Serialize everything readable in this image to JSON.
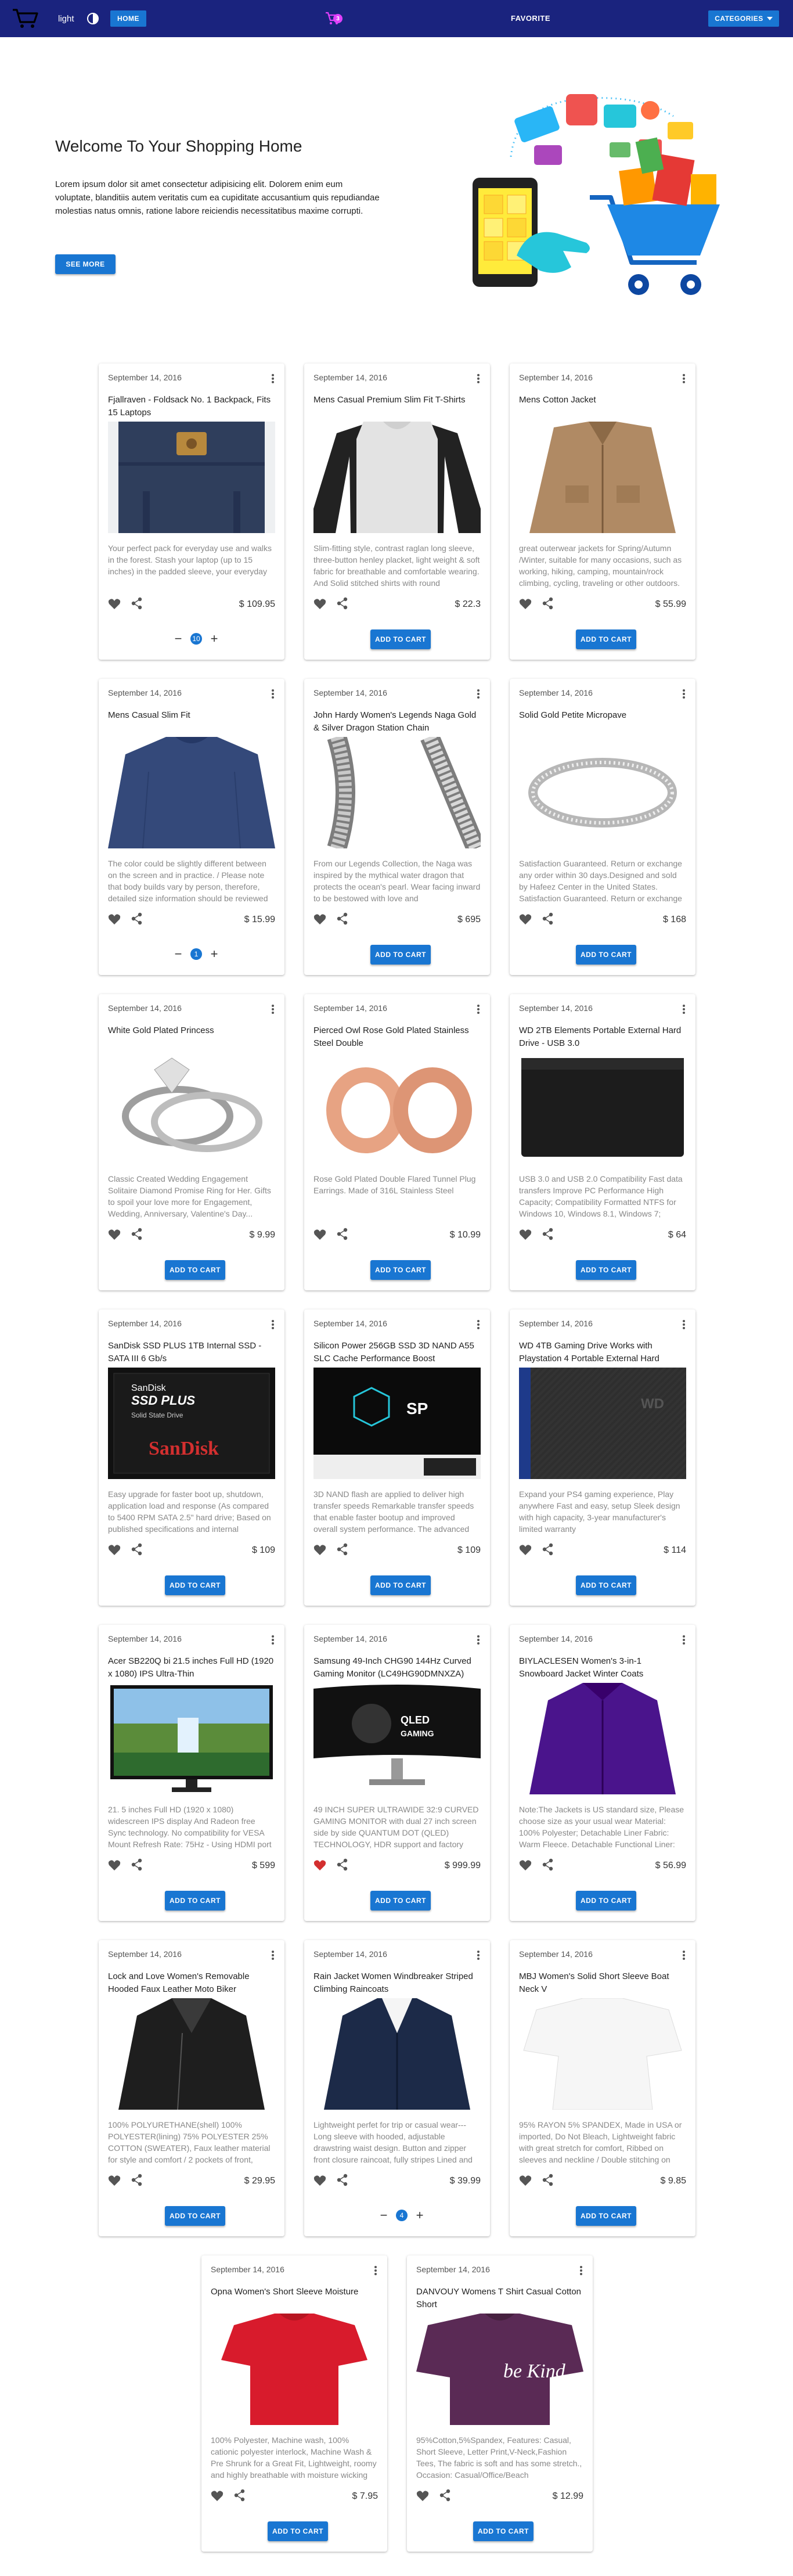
{
  "header": {
    "theme_label": "light",
    "home_label": "HOME",
    "cart_count": "3",
    "favorite_label": "FAVORITE",
    "categories_label": "CATEGORIES"
  },
  "hero": {
    "title": "Welcome To Your Shopping Home",
    "text": "Lorem ipsum dolor sit amet consectetur adipisicing elit. Dolorem enim eum voluptate, blanditiis autem veritatis cum ea cupiditate accusantium quis repudiandae molestias natus omnis, ratione labore reiciendis necessitatibus maxime corrupti.",
    "button": "SEE MORE"
  },
  "add_to_cart_label": "ADD TO CART",
  "products": [
    {
      "date": "September 14, 2016",
      "title": "Fjallraven - Foldsack No. 1 Backpack, Fits 15 Laptops",
      "desc": "Your perfect pack for everyday use and walks in the forest. Stash your laptop (up to 15 inches) in the padded sleeve, your everyday",
      "price": "$ 109.95",
      "qty": "10",
      "fav": false,
      "img": "backpack"
    },
    {
      "date": "September 14, 2016",
      "title": "Mens Casual Premium Slim Fit T-Shirts",
      "desc": "Slim-fitting style, contrast raglan long sleeve, three-button henley placket, light weight & soft fabric for breathable and comfortable wearing. And Solid stitched shirts with round",
      "price": "$ 22.3",
      "qty": null,
      "fav": false,
      "img": "tshirt"
    },
    {
      "date": "September 14, 2016",
      "title": "Mens Cotton Jacket",
      "desc": "great outerwear jackets for Spring/Autumn /Winter, suitable for many occasions, such as working, hiking, camping, mountain/rock climbing, cycling, traveling or other outdoors.",
      "price": "$ 55.99",
      "qty": null,
      "fav": false,
      "img": "jacket"
    },
    {
      "date": "September 14, 2016",
      "title": "Mens Casual Slim Fit",
      "desc": "The color could be slightly different between on the screen and in practice. / Please note that body builds vary by person, therefore, detailed size information should be reviewed",
      "price": "$ 15.99",
      "qty": "1",
      "fav": false,
      "img": "longsleeve"
    },
    {
      "date": "September 14, 2016",
      "title": "John Hardy Women's Legends Naga Gold & Silver Dragon Station Chain",
      "desc": "From our Legends Collection, the Naga was inspired by the mythical water dragon that protects the ocean's pearl. Wear facing inward to be bestowed with love and",
      "price": "$ 695",
      "qty": null,
      "fav": false,
      "img": "chain"
    },
    {
      "date": "September 14, 2016",
      "title": "Solid Gold Petite Micropave",
      "desc": "Satisfaction Guaranteed. Return or exchange any order within 30 days.Designed and sold by Hafeez Center in the United States. Satisfaction Guaranteed. Return or exchange",
      "price": "$ 168",
      "qty": null,
      "fav": false,
      "img": "ring"
    },
    {
      "date": "September 14, 2016",
      "title": "White Gold Plated Princess",
      "desc": "Classic Created Wedding Engagement Solitaire Diamond Promise Ring for Her. Gifts to spoil your love more for Engagement, Wedding, Anniversary, Valentine's Day...",
      "price": "$ 9.99",
      "qty": null,
      "fav": false,
      "img": "rings2"
    },
    {
      "date": "September 14, 2016",
      "title": "Pierced Owl Rose Gold Plated Stainless Steel Double",
      "desc": "Rose Gold Plated Double Flared Tunnel Plug Earrings. Made of 316L Stainless Steel",
      "price": "$ 10.99",
      "qty": null,
      "fav": false,
      "img": "plugs"
    },
    {
      "date": "September 14, 2016",
      "title": "WD 2TB Elements Portable External Hard Drive - USB 3.0",
      "desc": "USB 3.0 and USB 2.0 Compatibility Fast data transfers Improve PC Performance High Capacity; Compatibility Formatted NTFS for Windows 10, Windows 8.1, Windows 7;",
      "price": "$ 64",
      "qty": null,
      "fav": false,
      "img": "hdd"
    },
    {
      "date": "September 14, 2016",
      "title": "SanDisk SSD PLUS 1TB Internal SSD - SATA III 6 Gb/s",
      "desc": "Easy upgrade for faster boot up, shutdown, application load and response (As compared to 5400 RPM SATA 2.5\" hard drive; Based on published specifications and internal",
      "price": "$ 109",
      "qty": null,
      "fav": false,
      "img": "sandisk"
    },
    {
      "date": "September 14, 2016",
      "title": "Silicon Power 256GB SSD 3D NAND A55 SLC Cache Performance Boost",
      "desc": "3D NAND flash are applied to deliver high transfer speeds Remarkable transfer speeds that enable faster bootup and improved overall system performance. The advanced",
      "price": "$ 109",
      "qty": null,
      "fav": false,
      "img": "sp"
    },
    {
      "date": "September 14, 2016",
      "title": "WD 4TB Gaming Drive Works with Playstation 4 Portable External Hard",
      "desc": "Expand your PS4 gaming experience, Play anywhere Fast and easy, setup Sleek design with high capacity, 3-year manufacturer's limited warranty",
      "price": "$ 114",
      "qty": null,
      "fav": false,
      "img": "wd4"
    },
    {
      "date": "September 14, 2016",
      "title": "Acer SB220Q bi 21.5 inches Full HD (1920 x 1080) IPS Ultra-Thin",
      "desc": "21. 5 inches Full HD (1920 x 1080) widescreen IPS display And Radeon free Sync technology. No compatibility for VESA Mount Refresh Rate: 75Hz - Using HDMI port",
      "price": "$ 599",
      "qty": null,
      "fav": false,
      "img": "acer"
    },
    {
      "date": "September 14, 2016",
      "title": "Samsung 49-Inch CHG90 144Hz Curved Gaming Monitor (LC49HG90DMNXZA)",
      "desc": "49 INCH SUPER ULTRAWIDE 32:9 CURVED GAMING MONITOR with dual 27 inch screen side by side QUANTUM DOT (QLED) TECHNOLOGY, HDR support and factory",
      "price": "$ 999.99",
      "qty": null,
      "fav": true,
      "img": "samsung"
    },
    {
      "date": "September 14, 2016",
      "title": "BIYLACLESEN Women's 3-in-1 Snowboard Jacket Winter Coats",
      "desc": "Note:The Jackets is US standard size, Please choose size as your usual wear Material: 100% Polyester; Detachable Liner Fabric: Warm Fleece. Detachable Functional Liner:",
      "price": "$ 56.99",
      "qty": null,
      "fav": false,
      "img": "purplejacket"
    },
    {
      "date": "September 14, 2016",
      "title": "Lock and Love Women's Removable Hooded Faux Leather Moto Biker",
      "desc": "100% POLYURETHANE(shell) 100% POLYESTER(lining) 75% POLYESTER 25% COTTON (SWEATER), Faux leather material for style and comfort / 2 pockets of front,",
      "price": "$ 29.95",
      "qty": null,
      "fav": false,
      "img": "leather"
    },
    {
      "date": "September 14, 2016",
      "title": "Rain Jacket Women Windbreaker Striped Climbing Raincoats",
      "desc": "Lightweight perfet for trip or casual wear---Long sleeve with hooded, adjustable drawstring waist design. Button and zipper front closure raincoat, fully stripes Lined and",
      "price": "$ 39.99",
      "qty": "4",
      "fav": false,
      "img": "raincoat"
    },
    {
      "date": "September 14, 2016",
      "title": "MBJ Women's Solid Short Sleeve Boat Neck V",
      "desc": "95% RAYON 5% SPANDEX, Made in USA or imported, Do Not Bleach, Lightweight fabric with great stretch for comfort, Ribbed on sleeves and neckline / Double stitching on",
      "price": "$ 9.85",
      "qty": null,
      "fav": false,
      "img": "whitetop"
    },
    {
      "date": "September 14, 2016",
      "title": "Opna Women's Short Sleeve Moisture",
      "desc": "100% Polyester, Machine wash, 100% cationic polyester interlock, Machine Wash & Pre Shrunk for a Great Fit, Lightweight, roomy and highly breathable with moisture wicking",
      "price": "$ 7.95",
      "qty": null,
      "fav": false,
      "img": "redtee"
    },
    {
      "date": "September 14, 2016",
      "title": "DANVOUY Womens T Shirt Casual Cotton Short",
      "desc": "95%Cotton,5%Spandex, Features: Casual, Short Sleeve, Letter Print,V-Neck,Fashion Tees, The fabric is soft and has some stretch., Occasion: Casual/Office/Beach",
      "price": "$ 12.99",
      "qty": null,
      "fav": false,
      "img": "kindtee",
      "img_text": "be Kind"
    }
  ]
}
